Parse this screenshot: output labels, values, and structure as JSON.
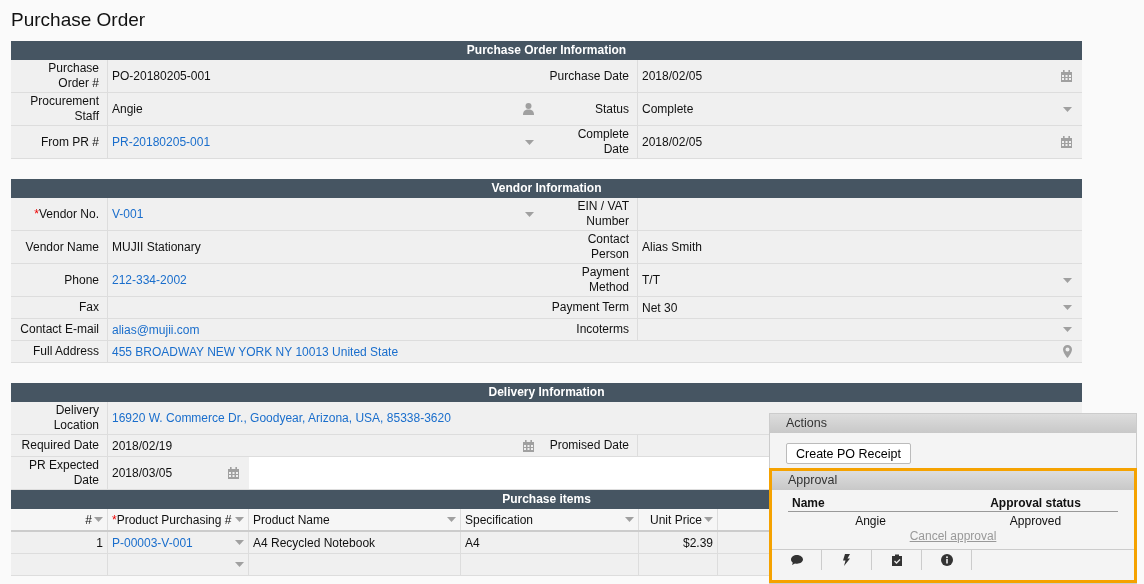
{
  "title": "Purchase Order",
  "sections": [
    {
      "title": "Purchase Order Information",
      "rows": [
        {
          "kind": "pair",
          "fields": [
            {
              "label": "Purchase\nOrder #",
              "value": "PO-20180205-001",
              "link": false,
              "kind": "text"
            },
            {
              "label": "Purchase Date",
              "value": "2018/02/05",
              "link": false,
              "kind": "date"
            }
          ]
        },
        {
          "kind": "pair",
          "fields": [
            {
              "label": "Procurement\nStaff",
              "value": "Angie",
              "link": false,
              "kind": "user"
            },
            {
              "label": "Status",
              "value": "Complete",
              "link": false,
              "kind": "select"
            }
          ]
        },
        {
          "kind": "pair",
          "fields": [
            {
              "label": "From PR #",
              "value": "PR-20180205-001",
              "link": true,
              "kind": "select"
            },
            {
              "label": "Complete\nDate",
              "value": "2018/02/05",
              "link": false,
              "kind": "date"
            }
          ]
        }
      ]
    },
    {
      "title": "Vendor Information",
      "rows": [
        {
          "kind": "pair",
          "fields": [
            {
              "label": "Vendor No.",
              "required_mark": "*",
              "value": "V-001",
              "link": true,
              "kind": "select"
            },
            {
              "label": "EIN / VAT\nNumber",
              "kind": "text"
            }
          ]
        },
        {
          "kind": "pair",
          "fields": [
            {
              "label": "Vendor Name",
              "value": "MUJII Stationary",
              "link": false,
              "kind": "text"
            },
            {
              "label": "Contact\nPerson",
              "value": "Alias Smith",
              "link": false,
              "kind": "text"
            }
          ]
        },
        {
          "kind": "pair",
          "fields": [
            {
              "label": "Phone",
              "value": "212-334-2002",
              "link": true,
              "kind": "text"
            },
            {
              "label": "Payment\nMethod",
              "value": "T/T",
              "link": false,
              "kind": "select"
            }
          ]
        },
        {
          "kind": "pair",
          "fields": [
            {
              "label": "Fax",
              "kind": "text"
            },
            {
              "label": "Payment Term",
              "value": "Net 30",
              "link": false,
              "kind": "select"
            }
          ]
        },
        {
          "kind": "pair",
          "fields": [
            {
              "label": "Contact E-mail",
              "value": "alias@mujii.com",
              "link": true,
              "kind": "text"
            },
            {
              "label": "Incoterms",
              "kind": "select"
            }
          ]
        },
        {
          "kind": "full",
          "fields": [
            {
              "label": "Full Address",
              "value": "455 BROADWAY NEW YORK NY 10013 United State",
              "link": true,
              "kind": "location"
            }
          ]
        }
      ]
    },
    {
      "title": "Delivery Information",
      "rows": [
        {
          "kind": "full",
          "fields": [
            {
              "label": "Delivery\nLocation",
              "value": "16920 W. Commerce Dr., Goodyear, Arizona, USA, 85338-3620",
              "link": true,
              "kind": "text"
            }
          ]
        },
        {
          "kind": "pair",
          "fields": [
            {
              "label": "Required Date",
              "value": "2018/02/19",
              "link": false,
              "kind": "date"
            },
            {
              "label": "Promised Date",
              "kind": "text"
            }
          ]
        },
        {
          "kind": "short",
          "fields": [
            {
              "label": "PR Expected\nDate",
              "value": "2018/03/05",
              "link": false,
              "kind": "date"
            }
          ]
        }
      ]
    }
  ],
  "items": {
    "title": "Purchase items",
    "columns": [
      {
        "label": "#"
      },
      {
        "label": "Product Purchasing #",
        "required_mark": "*"
      },
      {
        "label": "Product Name"
      },
      {
        "label": "Specification"
      },
      {
        "label": "Unit Price"
      }
    ],
    "rows": [
      {
        "number": "1",
        "product_no": "P-00003-V-001",
        "product_name": "A4 Recycled Notebook",
        "specification": "A4",
        "unit_price": "$2.39"
      }
    ]
  },
  "actions": {
    "title": "Actions",
    "buttons": [
      "Create PO Receipt"
    ]
  },
  "approval": {
    "title": "Approval",
    "columns": [
      "Name",
      "Approval status"
    ],
    "rows": [
      {
        "name": "Angie",
        "status": "Approved"
      }
    ],
    "cancel_link": "Cancel approval",
    "toolbar": [
      {
        "kind": "comment"
      },
      {
        "kind": "bolt"
      },
      {
        "kind": "clipboard"
      },
      {
        "kind": "info"
      }
    ]
  }
}
